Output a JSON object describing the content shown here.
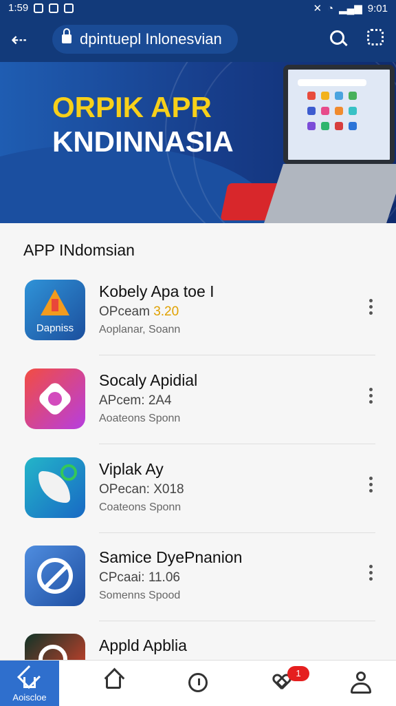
{
  "status": {
    "time": "1:59",
    "battery": "9:01"
  },
  "topbar": {
    "url": "dpintuepl Inlonesvian"
  },
  "banner": {
    "line1": "ORPIK APR",
    "line2": "KNDINNASIA"
  },
  "section": {
    "title": "APP INdomsian"
  },
  "apps": [
    {
      "name": "Kobely Apa toe I",
      "price_label": "OPceam",
      "price_value": "3.20",
      "subtitle": "Aoplanar, Soann",
      "icon_label": "Dapniss"
    },
    {
      "name": "Socaly Apidial",
      "price_label": "APcem:",
      "price_value": "2A4",
      "subtitle": "Aoateons Sponn"
    },
    {
      "name": "Viplak Ay",
      "price_label": "OPecan:",
      "price_value": "X018",
      "subtitle": "Coateons Sponn"
    },
    {
      "name": "Samice DyePnanion",
      "price_label": "CPcaai:",
      "price_value": "11.06",
      "subtitle": "Somenns Spood"
    },
    {
      "name": "Appld Apblia",
      "price_label": "",
      "price_value": "",
      "subtitle": ""
    }
  ],
  "bottom_nav": {
    "active_label": "Aoiscloe",
    "badge": "1"
  }
}
